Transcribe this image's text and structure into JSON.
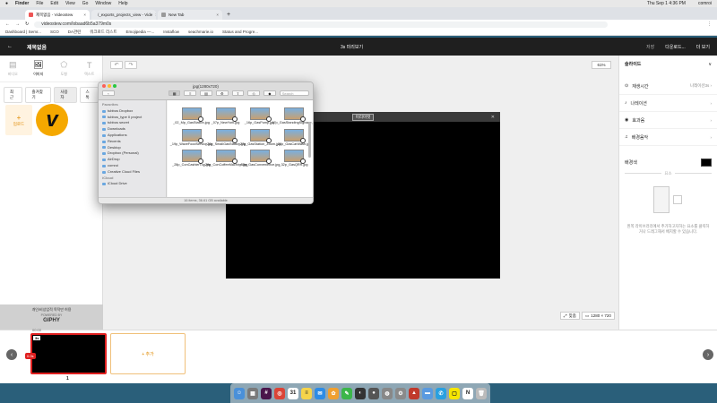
{
  "menubar": {
    "app": "Finder",
    "items": [
      "File",
      "Edit",
      "View",
      "Go",
      "Window",
      "Help"
    ],
    "clock": "Thu Sep 1  4:36 PM",
    "user": "comroi"
  },
  "browser": {
    "tabs": [
      {
        "label": "제목없음 - Videostew"
      },
      {
        "label": "/_exports_projects_view - Vide"
      },
      {
        "label": "New Tab"
      }
    ],
    "url": "videostew.com/lobaad6b5a379m0s",
    "bookmarks": [
      "Dashboard | Semr...",
      "SCO",
      "DA관련",
      "워크로드 리스트",
      "Emojipedia —...",
      "Instaflow",
      "seachmarie.io",
      "Status and Progre..."
    ]
  },
  "app": {
    "back_glyph": "←",
    "title": "제목없음",
    "center": "3s  미리보기",
    "save": "저장",
    "download": "다운로드...",
    "more": "더 보기"
  },
  "left": {
    "icons": [
      {
        "glyph": "▤",
        "label": "비디오"
      },
      {
        "glyph": "🖼",
        "label": "이미지"
      },
      {
        "glyph": "⬠",
        "label": "도형"
      },
      {
        "glyph": "T",
        "label": "텍스트"
      }
    ],
    "tabs": [
      "최근",
      "즐겨찾기",
      "사용자",
      "스톡"
    ],
    "upload": "업로드",
    "upload_glyph": "+",
    "logo_letter": "v",
    "giphy_note": "개인/비상업적 목적만 허용",
    "giphy_powered": "POWERED BY",
    "giphy_brand": "GIPHY"
  },
  "workspace": {
    "undo_glyph": "↶",
    "redo_glyph": "↷",
    "zoom": "61%",
    "canvas_label": "미리마컷",
    "canvas_close": "✕",
    "fit": "맞춤",
    "resolution": "1280 × 720"
  },
  "finder": {
    "title": "jpg(1280x720)",
    "search_placeholder": "Search",
    "sidebar": [
      {
        "type": "header",
        "label": "Favorites"
      },
      {
        "label": "tubbos Dropbox"
      },
      {
        "label": "tubbos_type II project"
      },
      {
        "label": "tubbos secret"
      },
      {
        "label": "Downloads"
      },
      {
        "label": "Applications"
      },
      {
        "label": "Recents"
      },
      {
        "label": "Desktop"
      },
      {
        "label": "Dropbox (Personal)"
      },
      {
        "label": "AirDrop"
      },
      {
        "label": "comroi"
      },
      {
        "label": "Creative Cloud Files"
      },
      {
        "type": "header",
        "label": "iCloud"
      },
      {
        "label": "iCloud Drive"
      }
    ],
    "files": [
      "_02_Mp_GasStation.jpg",
      "_07p_NewYork.jpg",
      "_16p_GasPump.jpg",
      "_17p_GasStandingSignage.jpg",
      "_19p_WaveFoodService.jpg",
      "_20p_SmallGasStation.jpg",
      "_27p_GasStation_Zoom.jpg",
      "_28p_GasCarWash.jpg",
      "_28p_ConCashierTop.jpg",
      "_29p_ConCoffeeMachine.jpg",
      "_30p_GasConvenience.jpg",
      "_32p_GasQRR.jpg"
    ],
    "status": "16 items, 36.61 GB available"
  },
  "right": {
    "title": "슬라이드",
    "title_close": "∨",
    "rows": [
      {
        "icon": "⊙",
        "label": "재생시간",
        "value": "나레이션3s ›"
      },
      {
        "icon": "♪",
        "label": "나레이션",
        "value": "›"
      },
      {
        "icon": "◉",
        "label": "효과음",
        "value": "›"
      },
      {
        "icon": "♫",
        "label": "배경음악",
        "value": "›"
      }
    ],
    "bgcolor_label": "배경색",
    "bgcolor": "#000000",
    "elements_label": "요소",
    "desc": "왼쪽 라이브러리에서 추가하고자하는 요소를 클릭하거나 드래그해서 배치할 수 있습니다."
  },
  "timeline": {
    "scene_time": "00:00",
    "scene_duration": "3s",
    "scene_badge": "0.0s",
    "add_label": "+ 추가",
    "scene_number": "1",
    "prev_glyph": "‹",
    "next_glyph": "›"
  },
  "dock": [
    {
      "name": "finder-icon",
      "color": "#4a90d9",
      "glyph": "☺"
    },
    {
      "name": "launchpad-icon",
      "color": "#7a7a7a",
      "glyph": "▦"
    },
    {
      "name": "slack-icon",
      "color": "#4a154b",
      "glyph": "#"
    },
    {
      "name": "chrome-icon",
      "color": "#db4437",
      "glyph": "◎"
    },
    {
      "name": "calendar-icon",
      "color": "#ffffff",
      "glyph": "31"
    },
    {
      "name": "notes-icon",
      "color": "#f6d44a",
      "glyph": "≡"
    },
    {
      "name": "mail-icon",
      "color": "#2d8ce6",
      "glyph": "✉"
    },
    {
      "name": "photos-icon",
      "color": "#f0a030",
      "glyph": "✿"
    },
    {
      "name": "messages-icon",
      "color": "#3cb64a",
      "glyph": "✎"
    },
    {
      "name": "cat-icon",
      "color": "#333333",
      "glyph": "◐"
    },
    {
      "name": "teams-icon",
      "color": "#555555",
      "glyph": "●"
    },
    {
      "name": "disk-icon",
      "color": "#888888",
      "glyph": "◍"
    },
    {
      "name": "settings-icon",
      "color": "#8a8a8a",
      "glyph": "⚙"
    },
    {
      "name": "app-icon",
      "color": "#c0392b",
      "glyph": "▲"
    },
    {
      "name": "folder-icon",
      "color": "#5a9ae0",
      "glyph": "▬"
    },
    {
      "name": "chat-icon",
      "color": "#2aa0e0",
      "glyph": "✆"
    },
    {
      "name": "kakaotalk-icon",
      "color": "#f7e600",
      "glyph": "▢"
    },
    {
      "name": "notion-icon",
      "color": "#ffffff",
      "glyph": "N"
    },
    {
      "name": "trash-icon",
      "color": "#bbbbbb",
      "glyph": "🗑"
    }
  ]
}
